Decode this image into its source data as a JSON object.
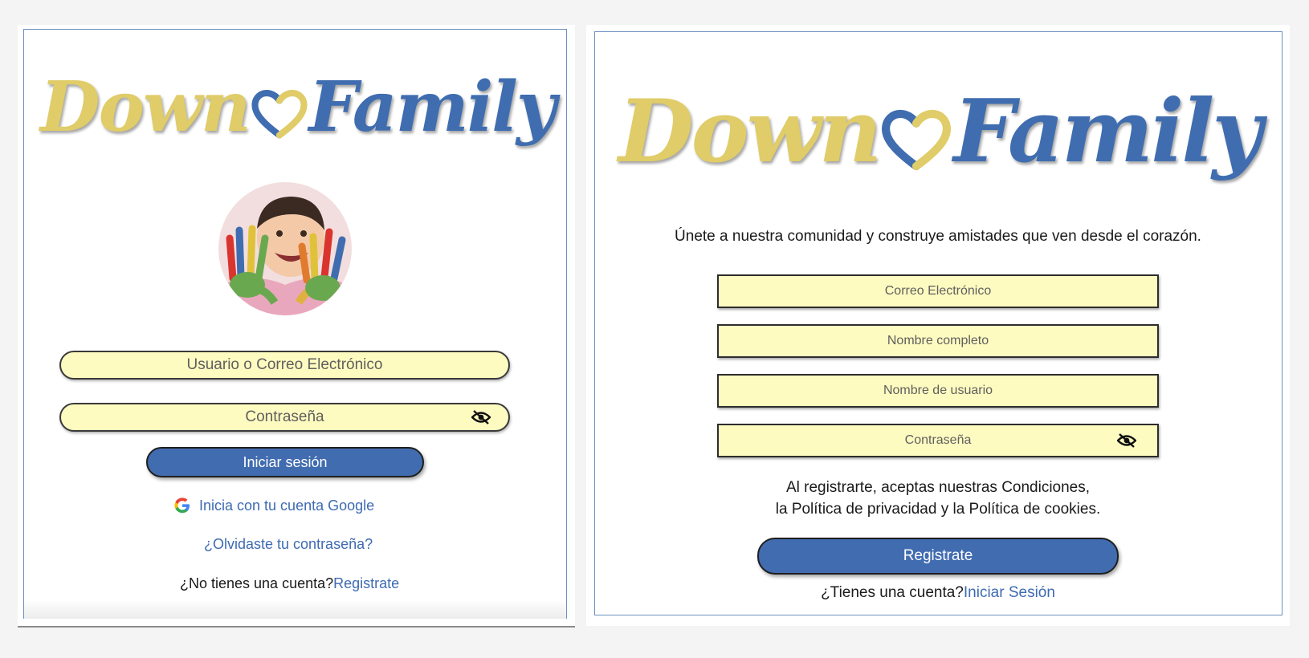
{
  "brand": {
    "logo_part1": "Down",
    "logo_part2": "Family",
    "yellow": "#e0cc68",
    "blue": "#3f6db0"
  },
  "login": {
    "user_placeholder": "Usuario o Correo Electrónico",
    "password_placeholder": "Contraseña",
    "submit_label": "Iniciar sesión",
    "google_label": "Inicia con tu cuenta Google",
    "forgot_label": "¿Olvidaste tu contraseña?",
    "no_account_text": "¿No tienes una cuenta?",
    "register_link": "Registrate"
  },
  "register": {
    "tagline": "Únete a nuestra comunidad y construye amistades que ven desde el corazón.",
    "email_placeholder": "Correo Electrónico",
    "fullname_placeholder": "Nombre completo",
    "username_placeholder": "Nombre de usuario",
    "password_placeholder": "Contraseña",
    "terms_line1": "Al registrarte, aceptas nuestras Condiciones,",
    "terms_line2": "la Política de privacidad y la Política de cookies.",
    "submit_label": "Registrate",
    "have_account_text": "¿Tienes una cuenta?",
    "login_link": "Iniciar Sesión"
  },
  "colors": {
    "input_bg": "#fefbc0",
    "button_bg": "#416cb0",
    "link": "#3e6bb1"
  }
}
